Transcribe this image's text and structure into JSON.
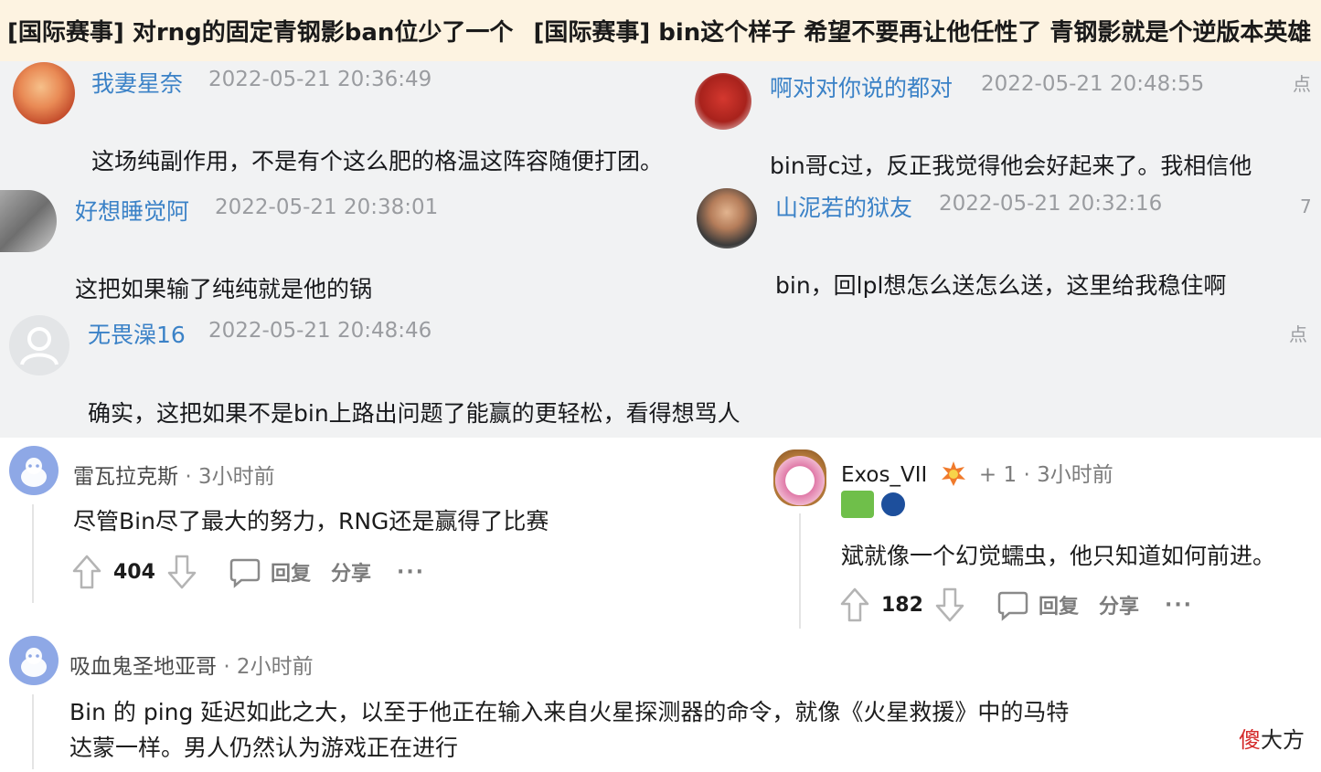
{
  "header": {
    "title_left": "[国际赛事] 对rng的固定青钢影ban位少了一个",
    "title_right": "[国际赛事] bin这个样子 希望不要再让他任性了 青钢影就是个逆版本英雄"
  },
  "bili_left": [
    {
      "name": "我妻星奈",
      "time": "2022-05-21 20:36:49",
      "text": "这场纯副作用，不是有个这么肥的格温这阵容随便打团。"
    },
    {
      "name": "好想睡觉阿",
      "time": "2022-05-21 20:38:01",
      "text": "这把如果输了纯纯就是他的锅"
    },
    {
      "name": "无畏澡16",
      "time": "2022-05-21 20:48:46",
      "text": "确实，这把如果不是bin上路出问题了能赢的更轻松，看得想骂人",
      "side_label": "点"
    }
  ],
  "bili_right": [
    {
      "name": "啊对对你说的都对",
      "time": "2022-05-21 20:48:55",
      "text": "bin哥c过，反正我觉得他会好起来了。我相信他",
      "side_label": "点"
    },
    {
      "name": "山泥若的狱友",
      "time": "2022-05-21 20:32:16",
      "text": "bin，回lpl想怎么送怎么送，这里给我稳住啊",
      "side_label": "7"
    }
  ],
  "reddit": [
    {
      "name": "雷瓦拉克斯",
      "meta": "· 3小时前",
      "text": "尽管Bin尽了最大的努力，RNG还是赢得了比赛",
      "votes": "404",
      "reply": "回复",
      "share": "分享",
      "more": "···"
    },
    {
      "name": "Exos_VII",
      "meta": "+ 1 · 3小时前",
      "text": "斌就像一个幻觉蠕虫，他只知道如何前进。",
      "votes": "182",
      "reply": "回复",
      "share": "分享",
      "more": "···"
    },
    {
      "name": "吸血鬼圣地亚哥",
      "meta": "· 2小时前",
      "text_line1": "Bin 的 ping 延迟如此之大，以至于他正在输入来自火星探测器的命令，就像《火星救援》中的马特",
      "text_line2": "达蒙一样。男人仍然认为游戏正在进行"
    }
  ],
  "watermark": {
    "red": "傻",
    "black": "大方"
  },
  "colors": {
    "header_bg": "#fdf3e1",
    "panel_bg": "#f1f2f3",
    "bili_name": "#3b82c7",
    "reddit_avatar": "#8ea8e6"
  }
}
